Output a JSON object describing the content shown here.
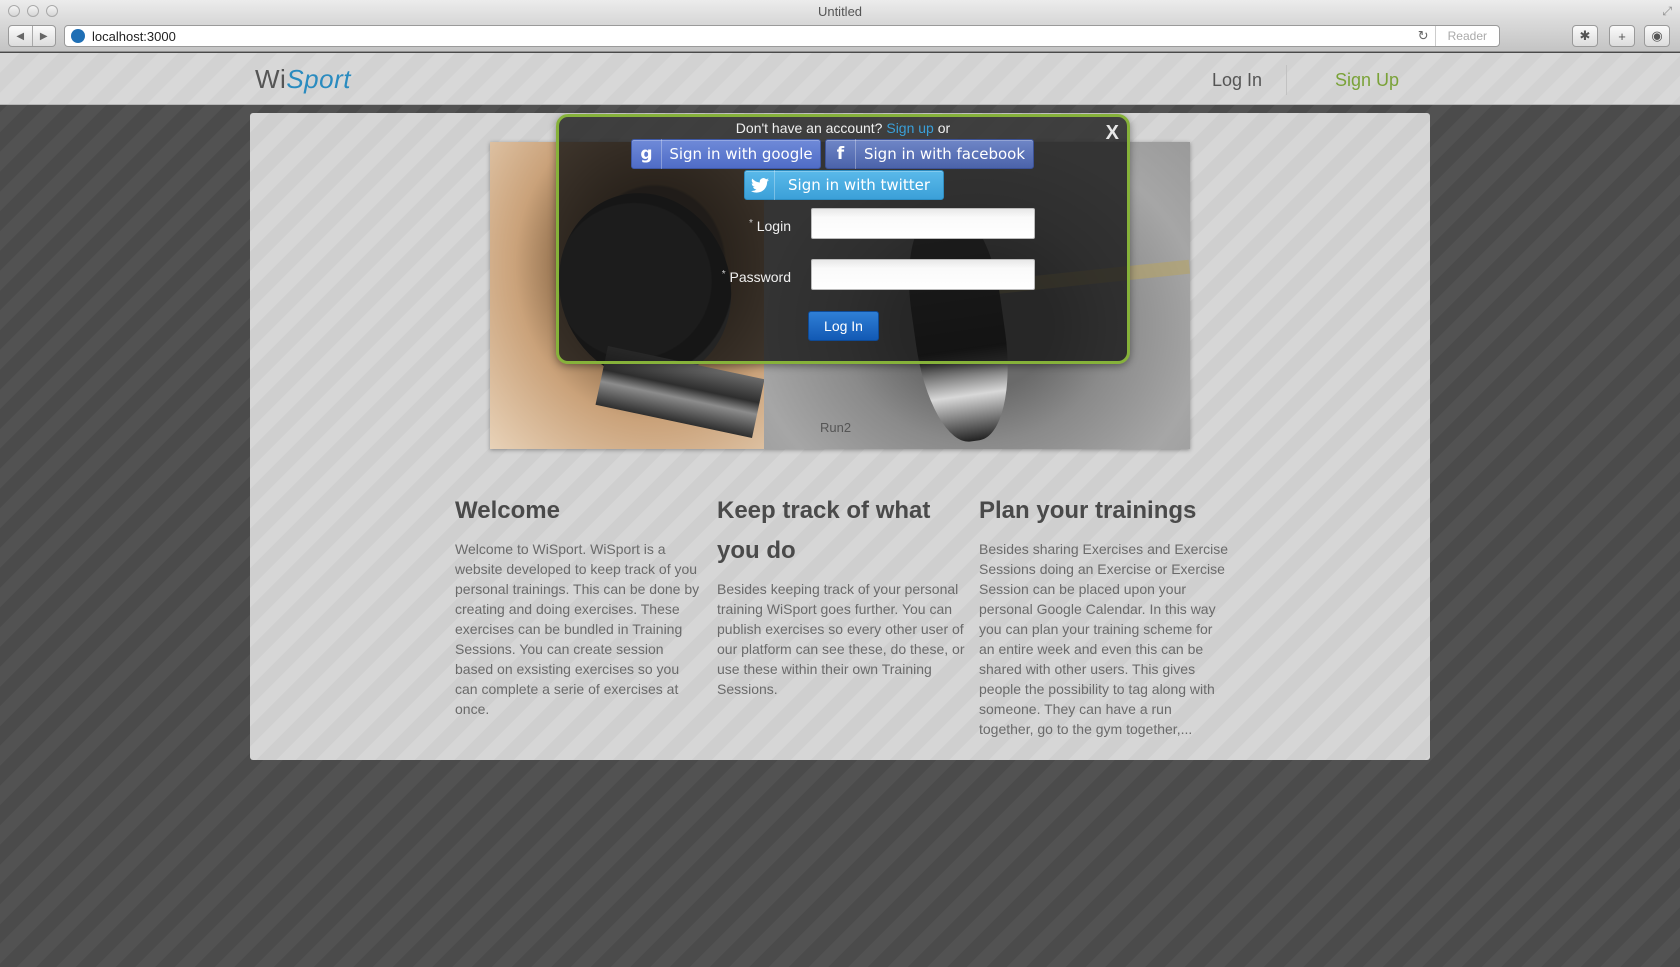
{
  "browser": {
    "window_title": "Untitled",
    "url": "localhost:3000",
    "reader_label": "Reader"
  },
  "site": {
    "logo_plain": "Wi",
    "logo_accent": "Sport",
    "nav": {
      "login": "Log In",
      "signup": "Sign Up"
    }
  },
  "hero": {
    "caption": "Run2"
  },
  "columns": [
    {
      "title": "Welcome",
      "body": "Welcome to WiSport. WiSport is a website developed to keep track of you personal trainings. This can be done by creating and doing exercises. These exercises can be bundled in Training Sessions. You can create session based on exsisting exercises so you can complete a serie of exercises at once."
    },
    {
      "title": "Keep track of what you do",
      "body": "Besides keeping track of your personal training WiSport goes further. You can publish exercises so every other user of our platform can see these, do these, or use these within their own Training Sessions."
    },
    {
      "title": "Plan your trainings",
      "body": "Besides sharing Exercises and Exercise Sessions doing an Exercise or Exercise Session can be placed upon your personal Google Calendar. In this way you can plan your training scheme for an entire week and even this can be shared with other users. This gives people the possibility to tag along with someone. They can have a run together, go to the gym together,..."
    }
  ],
  "modal": {
    "prompt_before": "Don't have an account?",
    "prompt_link": "Sign up",
    "prompt_after": "or",
    "close": "X",
    "google_label": "Sign in with google",
    "facebook_label": "Sign in with facebook",
    "twitter_label": "Sign in with twitter",
    "required_mark": "*",
    "login_label": "Login",
    "password_label": "Password",
    "login_value": "",
    "password_value": "",
    "submit_label": "Log In"
  },
  "colors": {
    "brand_blue": "#2a8bbf",
    "signup_green": "#7aa238",
    "modal_border": "#86b23a",
    "login_button": "#1259b4"
  }
}
